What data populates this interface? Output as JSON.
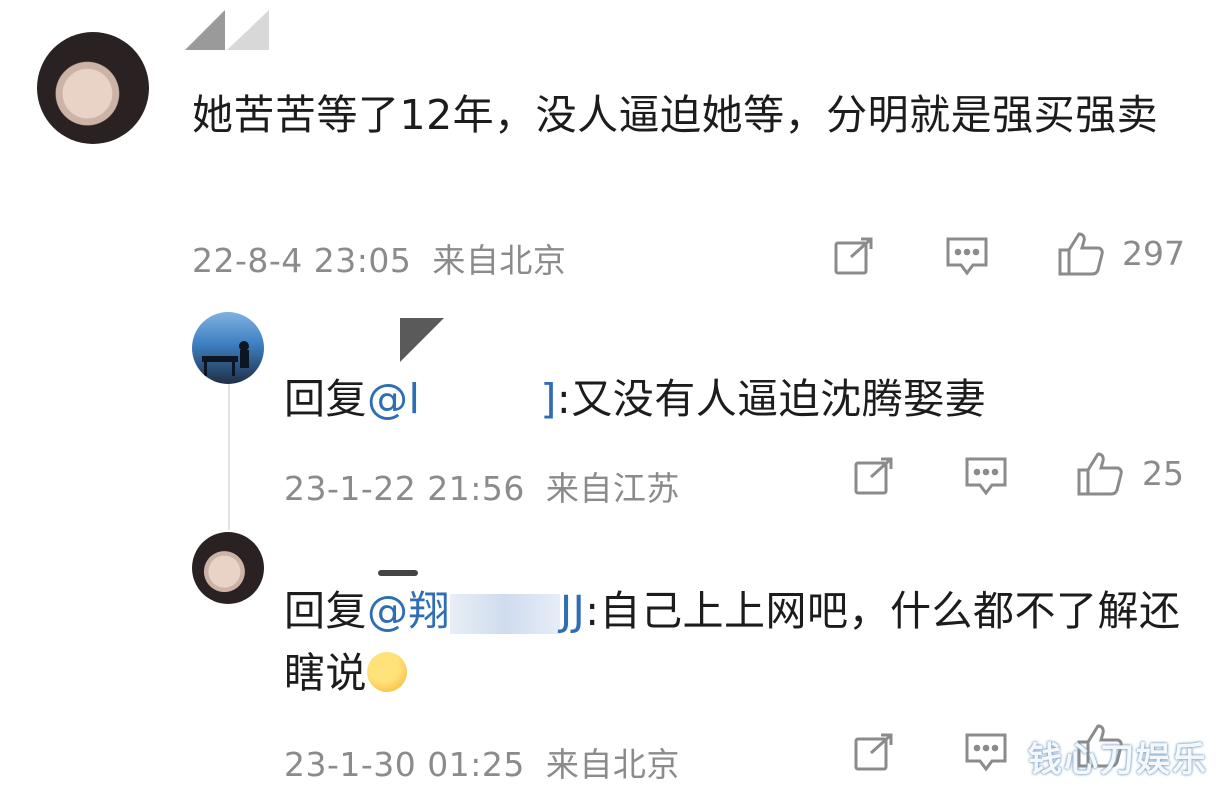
{
  "comments": [
    {
      "text": "她苦苦等了12年，没人逼迫她等，分明就是强买强卖",
      "timestamp": "22-8-4 23:05",
      "location": "来自北京",
      "like_count": "297"
    },
    {
      "reply_prefix": "回复",
      "at_mention": "@l",
      "after_mention": "]",
      "reply_text": ":又没有人逼迫沈腾娶妻",
      "timestamp": "23-1-22 21:56",
      "location": "来自江苏",
      "like_count": "25"
    },
    {
      "reply_prefix": "回复",
      "at_mention": "@翔",
      "after_mention": "JJ",
      "reply_text": ":自己上上网吧，什么都不了解还瞎说",
      "timestamp": "23-1-30 01:25",
      "location": "来自北京",
      "like_count": ""
    }
  ],
  "watermark": "钱心刀娱乐",
  "icons": {
    "share": "share-icon",
    "comment": "comment-icon",
    "like": "thumbs-up-icon"
  }
}
